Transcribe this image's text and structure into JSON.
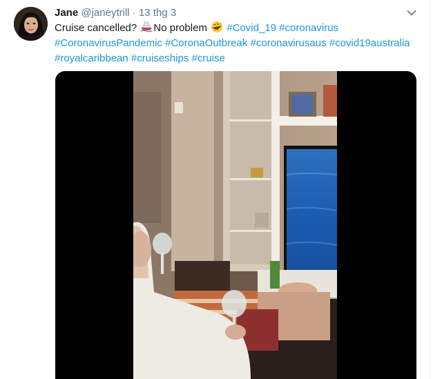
{
  "tweet": {
    "author_name": "Jane",
    "author_handle": "@janeytrill",
    "separator": "·",
    "date": "13 thg 3",
    "text_before_ship": "Cruise cancelled? ",
    "text_after_ship": "No problem ",
    "hashtags": [
      "#Covid_19",
      "#coronavirus",
      "#CoronavirusPandemic",
      "#CoronaOutbreak",
      "#coronavirusaus",
      "#covid19australia",
      "#royalcaribbean",
      "#cruiseships",
      "#cruise"
    ],
    "emojis": [
      "ship-emoji",
      "rolling-on-floor-laughing-emoji"
    ]
  },
  "colors": {
    "link": "#1b95e0",
    "text": "#14171a",
    "muted": "#657786",
    "media_bg": "#000000"
  },
  "icons": [
    "avatar-photo",
    "chevron-down-icon",
    "video-thumbnail"
  ]
}
